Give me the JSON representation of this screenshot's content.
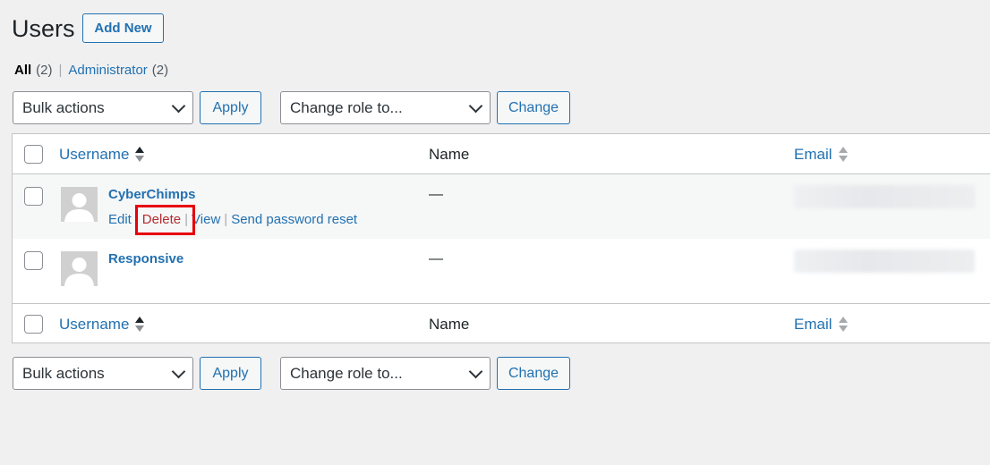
{
  "page": {
    "title": "Users",
    "add_new_label": "Add New"
  },
  "filters": [
    {
      "label": "All",
      "count": "(2)",
      "current": true
    },
    {
      "label": "Administrator",
      "count": "(2)",
      "current": false
    }
  ],
  "filter_separator": "|",
  "bulk": {
    "selected": "Bulk actions",
    "apply_label": "Apply"
  },
  "role": {
    "selected": "Change role to...",
    "change_label": "Change"
  },
  "table": {
    "columns": {
      "username": "Username",
      "name": "Name",
      "email": "Email"
    },
    "rows": [
      {
        "username": "CyberChimps",
        "name": "—",
        "actions": {
          "edit": "Edit",
          "delete": "Delete",
          "view": "View",
          "reset": "Send password reset"
        }
      },
      {
        "username": "Responsive",
        "name": "—"
      }
    ],
    "action_separator": "|"
  },
  "icons": {
    "avatar": "default-avatar-icon",
    "sort": "sort-arrows-icon",
    "dropdown": "chevron-down-icon"
  },
  "colors": {
    "link": "#2271b1",
    "delete": "#b32d2e",
    "highlight": "#e8000b",
    "background": "#f0f0f1"
  }
}
